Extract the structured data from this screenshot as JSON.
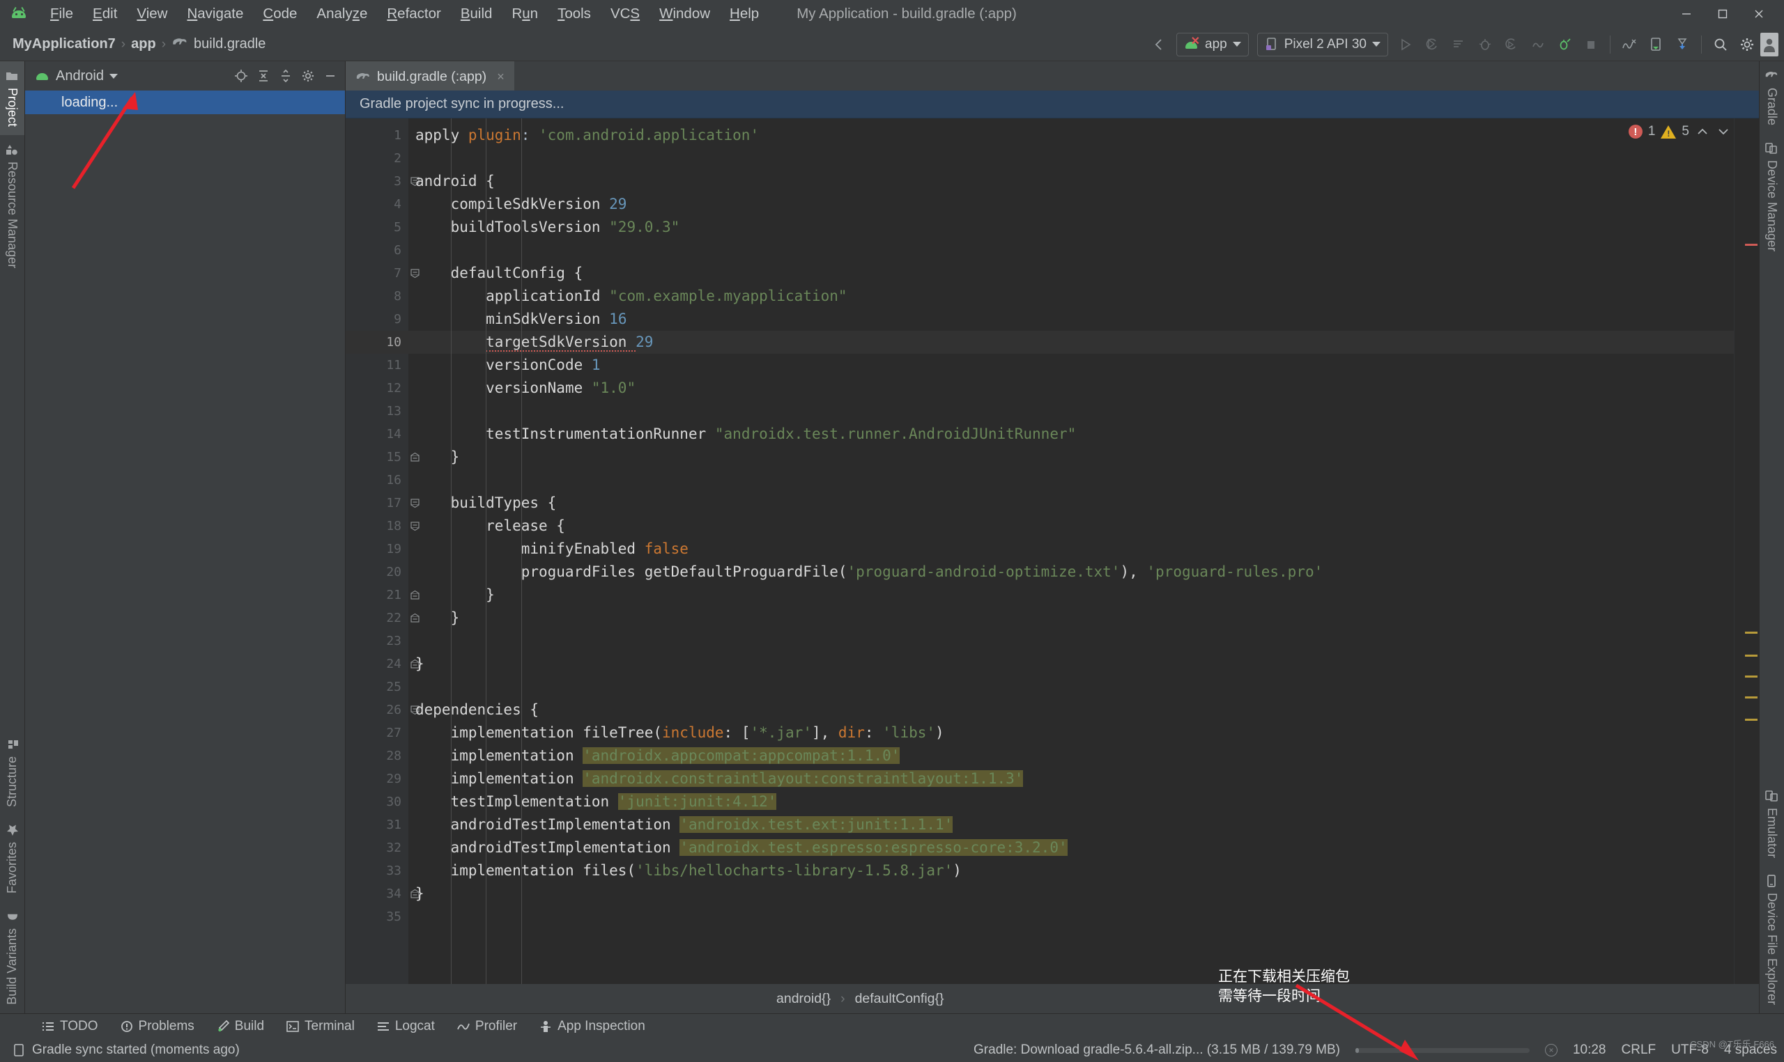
{
  "window": {
    "title": "My Application - build.gradle (:app)",
    "controls": [
      "minimize",
      "maximize",
      "close"
    ]
  },
  "menubar": {
    "logo": "android-logo",
    "items": [
      {
        "label": "File",
        "mnemonic": "F"
      },
      {
        "label": "Edit",
        "mnemonic": "E"
      },
      {
        "label": "View",
        "mnemonic": "V"
      },
      {
        "label": "Navigate",
        "mnemonic": "N"
      },
      {
        "label": "Code",
        "mnemonic": "C"
      },
      {
        "label": "Analyze",
        "mnemonic": "z"
      },
      {
        "label": "Refactor",
        "mnemonic": "R"
      },
      {
        "label": "Build",
        "mnemonic": "B"
      },
      {
        "label": "Run",
        "mnemonic": "u"
      },
      {
        "label": "Tools",
        "mnemonic": "T"
      },
      {
        "label": "VCS",
        "mnemonic": "S"
      },
      {
        "label": "Window",
        "mnemonic": "W"
      },
      {
        "label": "Help",
        "mnemonic": "H"
      }
    ]
  },
  "breadcrumb": {
    "items": [
      "MyApplication7",
      "app",
      "build.gradle"
    ],
    "separator": "›",
    "file_icon": "gradle-elephant-icon"
  },
  "toolbar": {
    "run_config": "app",
    "device": "Pixel 2 API 30",
    "icons": [
      "back-icon",
      "run-icon",
      "apply-changes-icon",
      "apply-code-changes-icon",
      "debug-icon",
      "run-coverage-icon",
      "profile-icon",
      "attach-debugger-icon",
      "stop-icon",
      "sdk-manager-icon",
      "avd-manager-icon",
      "sync-gradle-icon",
      "search-icon",
      "settings-icon",
      "avatar-icon"
    ]
  },
  "left_strip": {
    "top": [
      {
        "label": "Project",
        "icon": "folder-icon",
        "active": true
      },
      {
        "label": "Resource Manager",
        "icon": "resource-icon",
        "active": false
      }
    ],
    "bottom": [
      {
        "label": "Structure",
        "icon": "structure-icon"
      },
      {
        "label": "Favorites",
        "icon": "star-icon"
      },
      {
        "label": "Build Variants",
        "icon": "android-icon"
      }
    ]
  },
  "right_strip": {
    "top": [
      {
        "label": "Gradle",
        "icon": "gradle-elephant-icon"
      },
      {
        "label": "Device Manager",
        "icon": "device-manager-icon"
      }
    ],
    "bottom": [
      {
        "label": "Emulator",
        "icon": "emulator-icon"
      },
      {
        "label": "Device File Explorer",
        "icon": "device-file-icon"
      }
    ]
  },
  "project_panel": {
    "title": "Android",
    "header_icons": [
      "locate-icon",
      "expand-all-icon",
      "collapse-all-icon",
      "settings-icon",
      "hide-icon"
    ],
    "tree": [
      {
        "label": "loading...",
        "selected": true
      }
    ]
  },
  "editor": {
    "tab": {
      "label": "build.gradle (:app)",
      "icon": "gradle-elephant-icon",
      "close": "×"
    },
    "sync_banner": "Gradle project sync in progress...",
    "inspections": {
      "errors": "1",
      "warnings": "5",
      "up": "⌃",
      "down": "⌄"
    },
    "footer_crumbs": [
      "android{}",
      "defaultConfig{}"
    ],
    "current_line": 10,
    "lines": [
      {
        "n": 1,
        "tokens": [
          {
            "t": "apply ",
            "c": "white"
          },
          {
            "t": "plugin",
            "c": "kw"
          },
          {
            "t": ": ",
            "c": "plain"
          },
          {
            "t": "'com.android.application'",
            "c": "str"
          }
        ]
      },
      {
        "n": 2,
        "tokens": []
      },
      {
        "n": 3,
        "fold": "open",
        "tokens": [
          {
            "t": "android {",
            "c": "white"
          }
        ]
      },
      {
        "n": 4,
        "indent": 1,
        "tokens": [
          {
            "t": "compileSdkVersion ",
            "c": "white"
          },
          {
            "t": "29",
            "c": "num"
          }
        ]
      },
      {
        "n": 5,
        "indent": 1,
        "tokens": [
          {
            "t": "buildToolsVersion ",
            "c": "white"
          },
          {
            "t": "\"29.0.3\"",
            "c": "str"
          }
        ]
      },
      {
        "n": 6,
        "tokens": []
      },
      {
        "n": 7,
        "indent": 1,
        "fold": "open",
        "tokens": [
          {
            "t": "defaultConfig {",
            "c": "white"
          }
        ]
      },
      {
        "n": 8,
        "indent": 2,
        "tokens": [
          {
            "t": "applicationId ",
            "c": "white"
          },
          {
            "t": "\"com.example.myapplication\"",
            "c": "str"
          }
        ]
      },
      {
        "n": 9,
        "indent": 2,
        "tokens": [
          {
            "t": "minSdkVersion ",
            "c": "white"
          },
          {
            "t": "16",
            "c": "num"
          }
        ]
      },
      {
        "n": 10,
        "indent": 2,
        "current": true,
        "tokens": [
          {
            "t": "targetSdkVersion ",
            "c": "white squig"
          },
          {
            "t": "29",
            "c": "num"
          }
        ]
      },
      {
        "n": 11,
        "indent": 2,
        "tokens": [
          {
            "t": "versionCode ",
            "c": "white"
          },
          {
            "t": "1",
            "c": "num"
          }
        ]
      },
      {
        "n": 12,
        "indent": 2,
        "tokens": [
          {
            "t": "versionName ",
            "c": "white"
          },
          {
            "t": "\"1.0\"",
            "c": "str"
          }
        ]
      },
      {
        "n": 13,
        "tokens": []
      },
      {
        "n": 14,
        "indent": 2,
        "tokens": [
          {
            "t": "testInstrumentationRunner ",
            "c": "white"
          },
          {
            "t": "\"androidx.test.runner.AndroidJUnitRunner\"",
            "c": "str"
          }
        ]
      },
      {
        "n": 15,
        "indent": 1,
        "fold": "close",
        "tokens": [
          {
            "t": "}",
            "c": "white"
          }
        ]
      },
      {
        "n": 16,
        "tokens": []
      },
      {
        "n": 17,
        "indent": 1,
        "fold": "open",
        "tokens": [
          {
            "t": "buildTypes {",
            "c": "white"
          }
        ]
      },
      {
        "n": 18,
        "indent": 2,
        "fold": "open",
        "tokens": [
          {
            "t": "release {",
            "c": "white"
          }
        ]
      },
      {
        "n": 19,
        "indent": 3,
        "tokens": [
          {
            "t": "minifyEnabled ",
            "c": "white"
          },
          {
            "t": "false",
            "c": "kw"
          }
        ]
      },
      {
        "n": 20,
        "indent": 3,
        "tokens": [
          {
            "t": "proguardFiles getDefaultProguardFile(",
            "c": "white"
          },
          {
            "t": "'proguard-android-optimize.txt'",
            "c": "str"
          },
          {
            "t": "), ",
            "c": "white"
          },
          {
            "t": "'proguard-rules.pro'",
            "c": "str"
          }
        ]
      },
      {
        "n": 21,
        "indent": 2,
        "fold": "close",
        "tokens": [
          {
            "t": "}",
            "c": "white"
          }
        ]
      },
      {
        "n": 22,
        "indent": 1,
        "fold": "close",
        "tokens": [
          {
            "t": "}",
            "c": "white"
          }
        ]
      },
      {
        "n": 23,
        "tokens": []
      },
      {
        "n": 24,
        "fold": "close",
        "tokens": [
          {
            "t": "}",
            "c": "white"
          }
        ]
      },
      {
        "n": 25,
        "tokens": []
      },
      {
        "n": 26,
        "fold": "open",
        "tokens": [
          {
            "t": "dependencies {",
            "c": "white"
          }
        ]
      },
      {
        "n": 27,
        "indent": 1,
        "tokens": [
          {
            "t": "implementation fileTree(",
            "c": "white"
          },
          {
            "t": "include",
            "c": "kw"
          },
          {
            "t": ": [",
            "c": "white"
          },
          {
            "t": "'*.jar'",
            "c": "str"
          },
          {
            "t": "], ",
            "c": "white"
          },
          {
            "t": "dir",
            "c": "kw"
          },
          {
            "t": ": ",
            "c": "white"
          },
          {
            "t": "'libs'",
            "c": "str"
          },
          {
            "t": ")",
            "c": "white"
          }
        ]
      },
      {
        "n": 28,
        "indent": 1,
        "tokens": [
          {
            "t": "implementation ",
            "c": "white"
          },
          {
            "t": "'androidx.appcompat:appcompat:1.1.0'",
            "c": "str hl"
          }
        ]
      },
      {
        "n": 29,
        "indent": 1,
        "tokens": [
          {
            "t": "implementation ",
            "c": "white"
          },
          {
            "t": "'androidx.constraintlayout:constraintlayout:1.1.3'",
            "c": "str hl"
          }
        ]
      },
      {
        "n": 30,
        "indent": 1,
        "tokens": [
          {
            "t": "testImplementation ",
            "c": "white"
          },
          {
            "t": "'junit:junit:4.12'",
            "c": "str hl"
          }
        ]
      },
      {
        "n": 31,
        "indent": 1,
        "tokens": [
          {
            "t": "androidTestImplementation ",
            "c": "white"
          },
          {
            "t": "'androidx.test.ext:junit:1.1.1'",
            "c": "str hl"
          }
        ]
      },
      {
        "n": 32,
        "indent": 1,
        "tokens": [
          {
            "t": "androidTestImplementation ",
            "c": "white"
          },
          {
            "t": "'androidx.test.espresso:espresso-core:3.2.0'",
            "c": "str hl"
          }
        ]
      },
      {
        "n": 33,
        "indent": 1,
        "tokens": [
          {
            "t": "implementation files(",
            "c": "white"
          },
          {
            "t": "'libs/hellocharts-library-1.5.8.jar'",
            "c": "str"
          },
          {
            "t": ")",
            "c": "white"
          }
        ]
      },
      {
        "n": 34,
        "fold": "close",
        "tokens": [
          {
            "t": "}",
            "c": "white"
          }
        ]
      },
      {
        "n": 35,
        "tokens": []
      }
    ]
  },
  "toolwindow_bar": [
    {
      "label": "TODO",
      "icon": "todo-icon"
    },
    {
      "label": "Problems",
      "icon": "problems-icon"
    },
    {
      "label": "Build",
      "icon": "build-hammer-icon"
    },
    {
      "label": "Terminal",
      "icon": "terminal-icon"
    },
    {
      "label": "Logcat",
      "icon": "logcat-icon"
    },
    {
      "label": "Profiler",
      "icon": "profiler-icon"
    },
    {
      "label": "App Inspection",
      "icon": "app-inspection-icon"
    }
  ],
  "statusbar": {
    "message": "Gradle sync started (moments ago)",
    "message_icon": "ide-notification-icon",
    "task": "Gradle: Download gradle-5.6.4-all.zip... (3.15 MB / 139.79 MB)",
    "progress_percent": 2,
    "cancel": "×",
    "caret": "10:28",
    "line_separator": "CRLF",
    "encoding": "UTF-8",
    "indent": "4 spaces",
    "watermark": "CSDN @T乐乐 F666"
  },
  "annotations": [
    {
      "id": "download-note",
      "text": "正在下载相关压缩包\n需等待一段时间"
    }
  ],
  "colors": {
    "accent_green": "#5cc26a",
    "selection_blue": "#2f5d99",
    "banner_blue": "#2b4059",
    "error_red": "#cf5b56",
    "warning_yellow": "#e0b020",
    "string_green": "#6a8759",
    "keyword_orange": "#cc7832",
    "number_blue": "#6897bb",
    "highlight_olive": "#5e5b31",
    "arrow_red": "#e8212a"
  }
}
